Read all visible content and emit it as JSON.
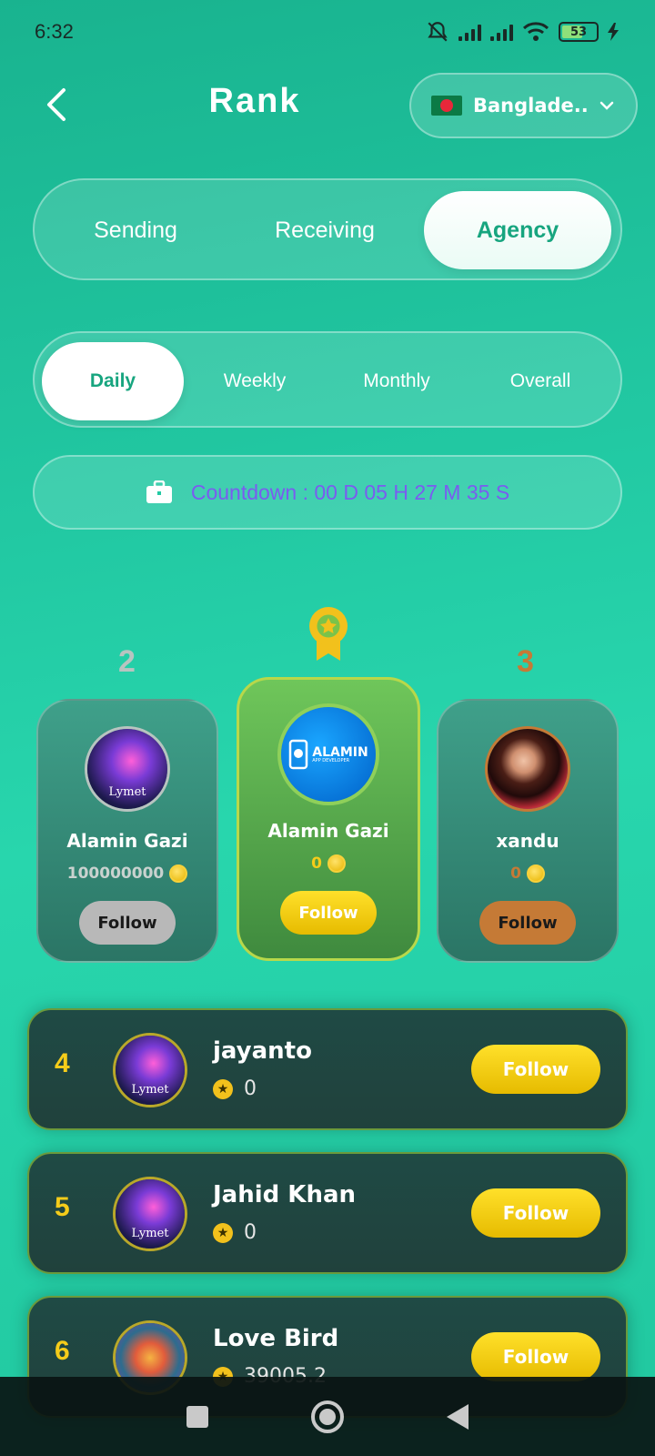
{
  "status_bar": {
    "time": "6:32",
    "battery": "53"
  },
  "header": {
    "title": "Rank",
    "country": "Banglade.."
  },
  "main_tabs": [
    {
      "label": "Sending"
    },
    {
      "label": "Receiving"
    },
    {
      "label": "Agency"
    }
  ],
  "period_tabs": [
    {
      "label": "Daily"
    },
    {
      "label": "Weekly"
    },
    {
      "label": "Monthly"
    },
    {
      "label": "Overall"
    }
  ],
  "countdown": {
    "text": "Countdown : 00 D 05 H 27 M 35 S"
  },
  "podium": {
    "first": {
      "rank": "1",
      "name": "Alamin Gazi",
      "coins": "0",
      "follow_label": "Follow",
      "avatar_text": "ALAMIN",
      "avatar_sub": "APP DEVELOPER"
    },
    "second": {
      "rank": "2",
      "name": "Alamin Gazi",
      "coins": "100000000",
      "follow_label": "Follow",
      "avatar_text": "Lymet"
    },
    "third": {
      "rank": "3",
      "name": "xandu",
      "coins": "0",
      "follow_label": "Follow"
    }
  },
  "list": [
    {
      "rank": "4",
      "name": "jayanto",
      "score": "0",
      "follow_label": "Follow",
      "avatar_text": "Lymet"
    },
    {
      "rank": "5",
      "name": "Jahid Khan",
      "score": "0",
      "follow_label": "Follow",
      "avatar_text": "Lymet"
    },
    {
      "rank": "6",
      "name": "Love Bird",
      "score": "39005.2",
      "follow_label": "Follow"
    }
  ],
  "colors": {
    "accent": "#17a57f",
    "gold": "#f5cc1a",
    "silver": "#b8b8b8",
    "bronze": "#c57a36",
    "countdown_text": "#7a5cf0"
  }
}
